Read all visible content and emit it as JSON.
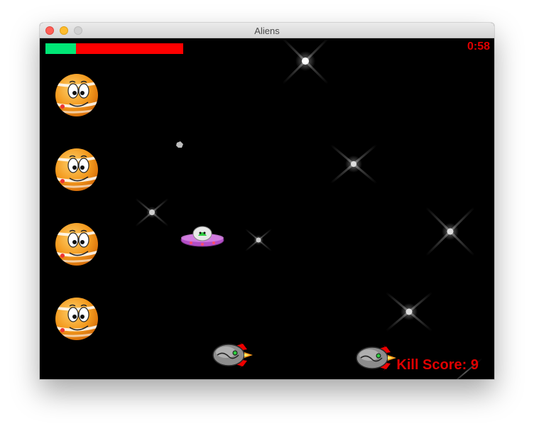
{
  "window": {
    "title": "Aliens"
  },
  "hud": {
    "health_fraction": 0.22,
    "timer": "0:58",
    "score_label": "Kill Score: 9"
  },
  "colors": {
    "health_good": "#00e676",
    "health_bad": "#ff0000",
    "hud_text": "#e00000",
    "background": "#000000"
  },
  "sprites": {
    "planets": 4,
    "ships": 2,
    "ufo": 1
  }
}
